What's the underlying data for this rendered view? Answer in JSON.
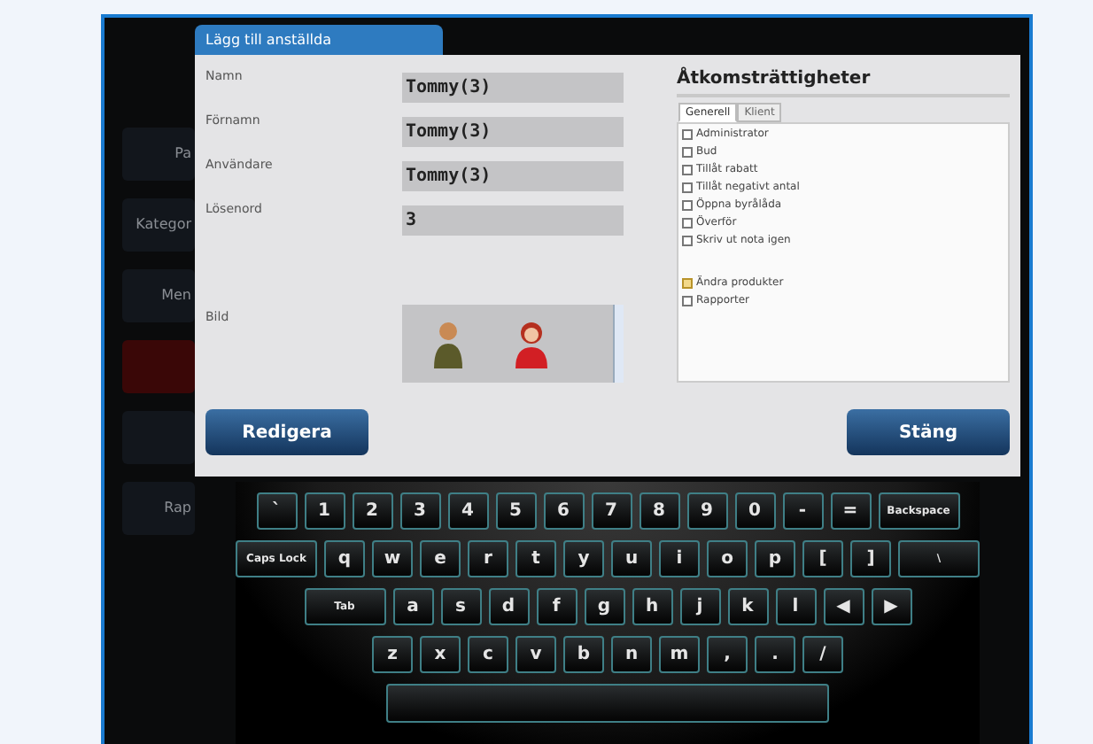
{
  "background_buttons": [
    {
      "label": "Pa",
      "kind": "dark"
    },
    {
      "label": "Kategor",
      "kind": "dark"
    },
    {
      "label": "Men",
      "kind": "dark"
    },
    {
      "kind": "red"
    },
    {
      "kind": "dark"
    },
    {
      "label": "Rap",
      "kind": "dark"
    }
  ],
  "dialog": {
    "title": "Lägg till anställda",
    "fields": [
      {
        "label": "Namn",
        "value": "Tommy(3)"
      },
      {
        "label": "Förnamn",
        "value": "Tommy(3)"
      },
      {
        "label": "Användare",
        "value": "Tommy(3)"
      },
      {
        "label": "Lösenord",
        "value": "3"
      }
    ],
    "picture_label": "Bild",
    "permissions": {
      "title": "Åtkomsträttigheter",
      "tabs": [
        {
          "label": "Generell",
          "selected": true
        },
        {
          "label": "Klient",
          "selected": false
        }
      ],
      "items": [
        {
          "label": "Administrator",
          "checked": false
        },
        {
          "label": "Bud",
          "checked": false
        },
        {
          "label": "Tillåt rabatt",
          "checked": false
        },
        {
          "label": "Tillåt negativt antal",
          "checked": false
        },
        {
          "label": "Öppna byrålåda",
          "checked": false
        },
        {
          "label": "Överför",
          "checked": false
        },
        {
          "label": "Skriv ut nota igen",
          "checked": false
        },
        {
          "label": "Ändra produkter",
          "checked": true
        },
        {
          "label": "Rapporter",
          "checked": false
        }
      ]
    },
    "buttons": [
      "Redigera",
      "Stäng"
    ]
  },
  "keyboard": {
    "rows": [
      [
        {
          "label": "`"
        },
        {
          "label": "1"
        },
        {
          "label": "2"
        },
        {
          "label": "3"
        },
        {
          "label": "4"
        },
        {
          "label": "5"
        },
        {
          "label": "6"
        },
        {
          "label": "7"
        },
        {
          "label": "8"
        },
        {
          "label": "9"
        },
        {
          "label": "0"
        },
        {
          "label": "-"
        },
        {
          "label": "="
        },
        {
          "label": "Backspace",
          "kind": "wide"
        }
      ],
      [
        {
          "label": "Caps Lock",
          "kind": "wide"
        },
        {
          "label": "q"
        },
        {
          "label": "w"
        },
        {
          "label": "e"
        },
        {
          "label": "r"
        },
        {
          "label": "t"
        },
        {
          "label": "y"
        },
        {
          "label": "u"
        },
        {
          "label": "i"
        },
        {
          "label": "o"
        },
        {
          "label": "p"
        },
        {
          "label": "["
        },
        {
          "label": "]"
        },
        {
          "label": "\\",
          "kind": "wide"
        }
      ],
      [
        {
          "label": "Tab",
          "kind": "wide"
        },
        {
          "label": "a"
        },
        {
          "label": "s"
        },
        {
          "label": "d"
        },
        {
          "label": "f"
        },
        {
          "label": "g"
        },
        {
          "label": "h"
        },
        {
          "label": "j"
        },
        {
          "label": "k"
        },
        {
          "label": "l"
        },
        {
          "label": "◀"
        },
        {
          "label": "▶"
        }
      ],
      [
        {
          "label": "z"
        },
        {
          "label": "x"
        },
        {
          "label": "c"
        },
        {
          "label": "v"
        },
        {
          "label": "b"
        },
        {
          "label": "n"
        },
        {
          "label": "m"
        },
        {
          "label": ","
        },
        {
          "label": "."
        },
        {
          "label": "/"
        }
      ],
      [
        {
          "kind": "space"
        }
      ]
    ]
  }
}
